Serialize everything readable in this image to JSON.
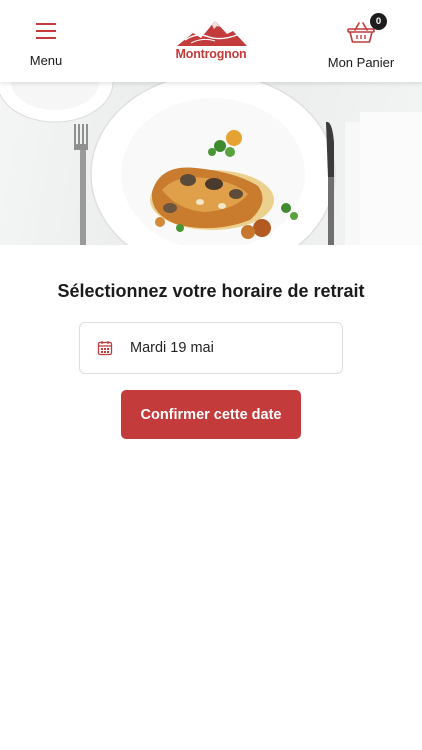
{
  "header": {
    "menu_label": "Menu",
    "menu_icon": "hamburger-icon",
    "logo_text": "Montrognon",
    "cart_label": "Mon Panier",
    "cart_icon": "basket-icon",
    "cart_count": "0"
  },
  "main": {
    "title": "Sélectionnez votre horaire de retrait",
    "date_value": "Mardi 19 mai",
    "date_icon": "calendar-icon",
    "confirm_label": "Confirmer cette date"
  },
  "colors": {
    "accent": "#c33b3b",
    "badge": "#1d1d1d",
    "border": "#dedede"
  }
}
